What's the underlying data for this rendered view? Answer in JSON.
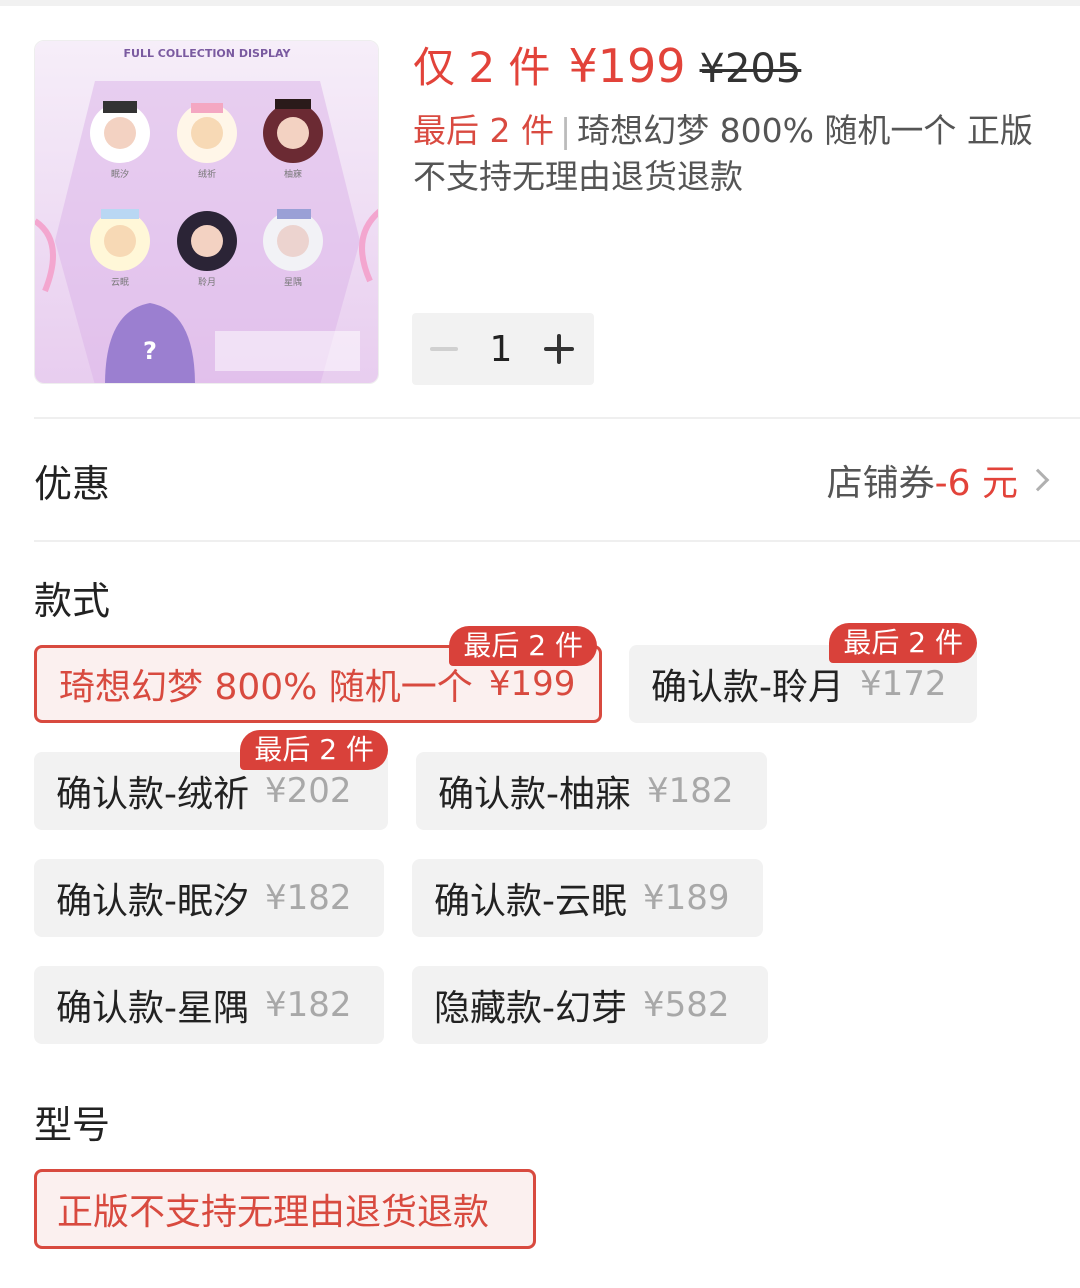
{
  "product": {
    "thumbnail_caption": "FULL COLLECTION DISPLAY",
    "thumbnail_figures": [
      "眠汐",
      "绒祈",
      "柚寐",
      "云眠",
      "聆月",
      "星隅"
    ],
    "price_prefix": "仅 2 件",
    "price_now": "¥199",
    "price_original": "¥205",
    "stock_note": "最后 2 件",
    "desc_separator": "|",
    "desc_text": "琦想幻梦 800% 随机一个 正版不支持无理由退货退款"
  },
  "quantity": {
    "value": "1"
  },
  "discount": {
    "label": "优惠",
    "coupon_label": "店铺券",
    "coupon_amount": "-6 元"
  },
  "style_section": {
    "title": "款式",
    "options": [
      {
        "name": "琦想幻梦 800% 随机一个",
        "price": "¥199",
        "badge": "最后 2 件",
        "selected": true
      },
      {
        "name": "确认款-聆月",
        "price": "¥172",
        "badge": "最后 2 件"
      },
      {
        "name": "确认款-绒祈",
        "price": "¥202",
        "badge": "最后 2 件"
      },
      {
        "name": "确认款-柚寐",
        "price": "¥182"
      },
      {
        "name": "确认款-眠汐",
        "price": "¥182"
      },
      {
        "name": "确认款-云眠",
        "price": "¥189"
      },
      {
        "name": "确认款-星隅",
        "price": "¥182"
      },
      {
        "name": "隐藏款-幻芽",
        "price": "¥582"
      }
    ]
  },
  "model_section": {
    "title": "型号",
    "options": [
      {
        "name": "正版不支持无理由退货退款",
        "selected": true
      }
    ]
  },
  "colors": {
    "accent": "#d84a3f",
    "price_red": "#e2433a",
    "option_bg": "#f2f2f2"
  }
}
